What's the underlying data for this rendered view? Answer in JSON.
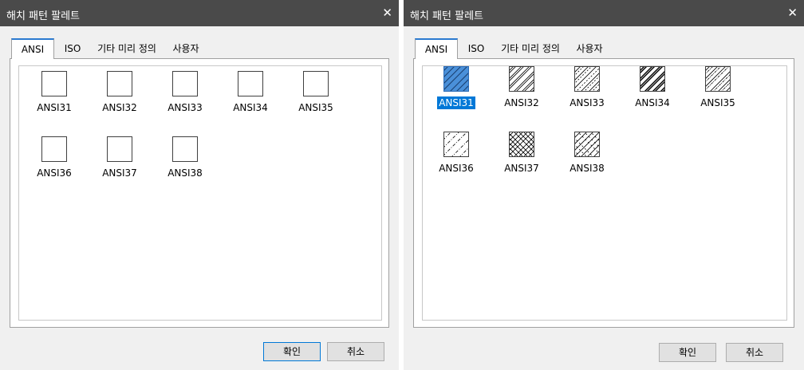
{
  "left": {
    "title": "해치 패턴 팔레트",
    "close": "✕",
    "tabs": [
      "ANSI",
      "ISO",
      "기타 미리 정의",
      "사용자"
    ],
    "items": [
      "ANSI31",
      "ANSI32",
      "ANSI33",
      "ANSI34",
      "ANSI35",
      "ANSI36",
      "ANSI37",
      "ANSI38"
    ],
    "ok": "확인",
    "cancel": "취소"
  },
  "right": {
    "title": "해치 패턴 팔레트",
    "close": "✕",
    "tabs": [
      "ANSI",
      "ISO",
      "기타 미리 정의",
      "사용자"
    ],
    "items": [
      "ANSI31",
      "ANSI32",
      "ANSI33",
      "ANSI34",
      "ANSI35",
      "ANSI36",
      "ANSI37",
      "ANSI38"
    ],
    "selected": "ANSI31",
    "ok": "확인",
    "cancel": "취소"
  },
  "colors": {
    "titlebar": "#4a4a4a",
    "selection": "#0078d7",
    "tab_accent": "#2b7ad0"
  },
  "icons": {
    "close": "close-icon"
  }
}
